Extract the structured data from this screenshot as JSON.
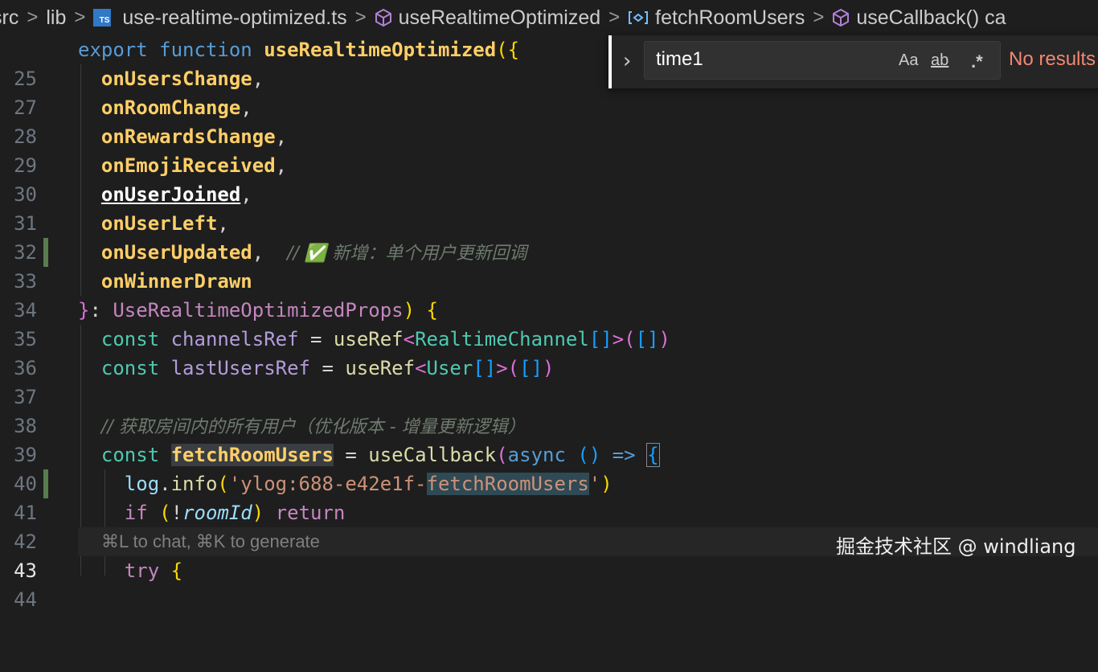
{
  "breadcrumb": {
    "items": [
      "src",
      "lib",
      "use-realtime-optimized.ts",
      "useRealtimeOptimized",
      "fetchRoomUsers",
      "useCallback() ca"
    ],
    "file_badge": "TS",
    "separator": ">"
  },
  "find_widget": {
    "toggle_icon": "chevron-right-icon",
    "query": "time1",
    "match_case_label": "Aa",
    "whole_word_label": "ab",
    "regex_label": ".*",
    "status": "No results"
  },
  "editor": {
    "active_line": "43",
    "line_numbers": [
      "25",
      "27",
      "28",
      "29",
      "30",
      "31",
      "32",
      "33",
      "34",
      "35",
      "36",
      "37",
      "38",
      "39",
      "40",
      "41",
      "42",
      "43",
      "44"
    ],
    "tokens": {
      "export": "export",
      "function": "function",
      "fn_name": "useRealtimeOptimized",
      "open_paren_brace": "({",
      "params": [
        "onUsersChange",
        "onRoomChange",
        "onRewardsChange",
        "onEmojiReceived",
        "onUserJoined",
        "onUserLeft",
        "onUserUpdated",
        "onWinnerDrawn"
      ],
      "comma": ",",
      "comment_33": "// ✅ 新增：单个用户更新回调",
      "close_brace": "}",
      "colon": ":",
      "props_type": "UseRealtimeOptimizedProps",
      "close_paren": ")",
      "open_brace": "{",
      "const": "const",
      "channels_ref": "channelsRef",
      "eq": "=",
      "use_ref": "useRef",
      "realtime_channel": "RealtimeChannel",
      "user_type": "User",
      "last_users_ref": "lastUsersRef",
      "comment_39": "// 获取房间内的所有用户（优化版本 - 增量更新逻辑）",
      "fetch_room_users": "fetchRoomUsers",
      "use_callback": "useCallback",
      "async": "async",
      "arrow": "=>",
      "log": "log",
      "info": "info",
      "log_str_prefix": "'ylog:688-e42e1f-",
      "log_str_hl": "fetchRoomUsers",
      "log_str_suffix": "'",
      "if": "if",
      "not": "!",
      "room_id": "roomId",
      "return": "return",
      "try": "try",
      "arr_generic": "[]>",
      "arr_empty": "[]"
    },
    "ghost_hint": "⌘L to chat, ⌘K to generate"
  },
  "watermark": "掘金技术社区 @ windliang",
  "colors": {
    "background": "#1e1e1e",
    "keyword": "#569cd6",
    "function": "#dcdcaa",
    "param": "#ffcf68",
    "type": "#4ec9b0",
    "no_results": "#f48771",
    "modified_bar": "#587c4f"
  }
}
